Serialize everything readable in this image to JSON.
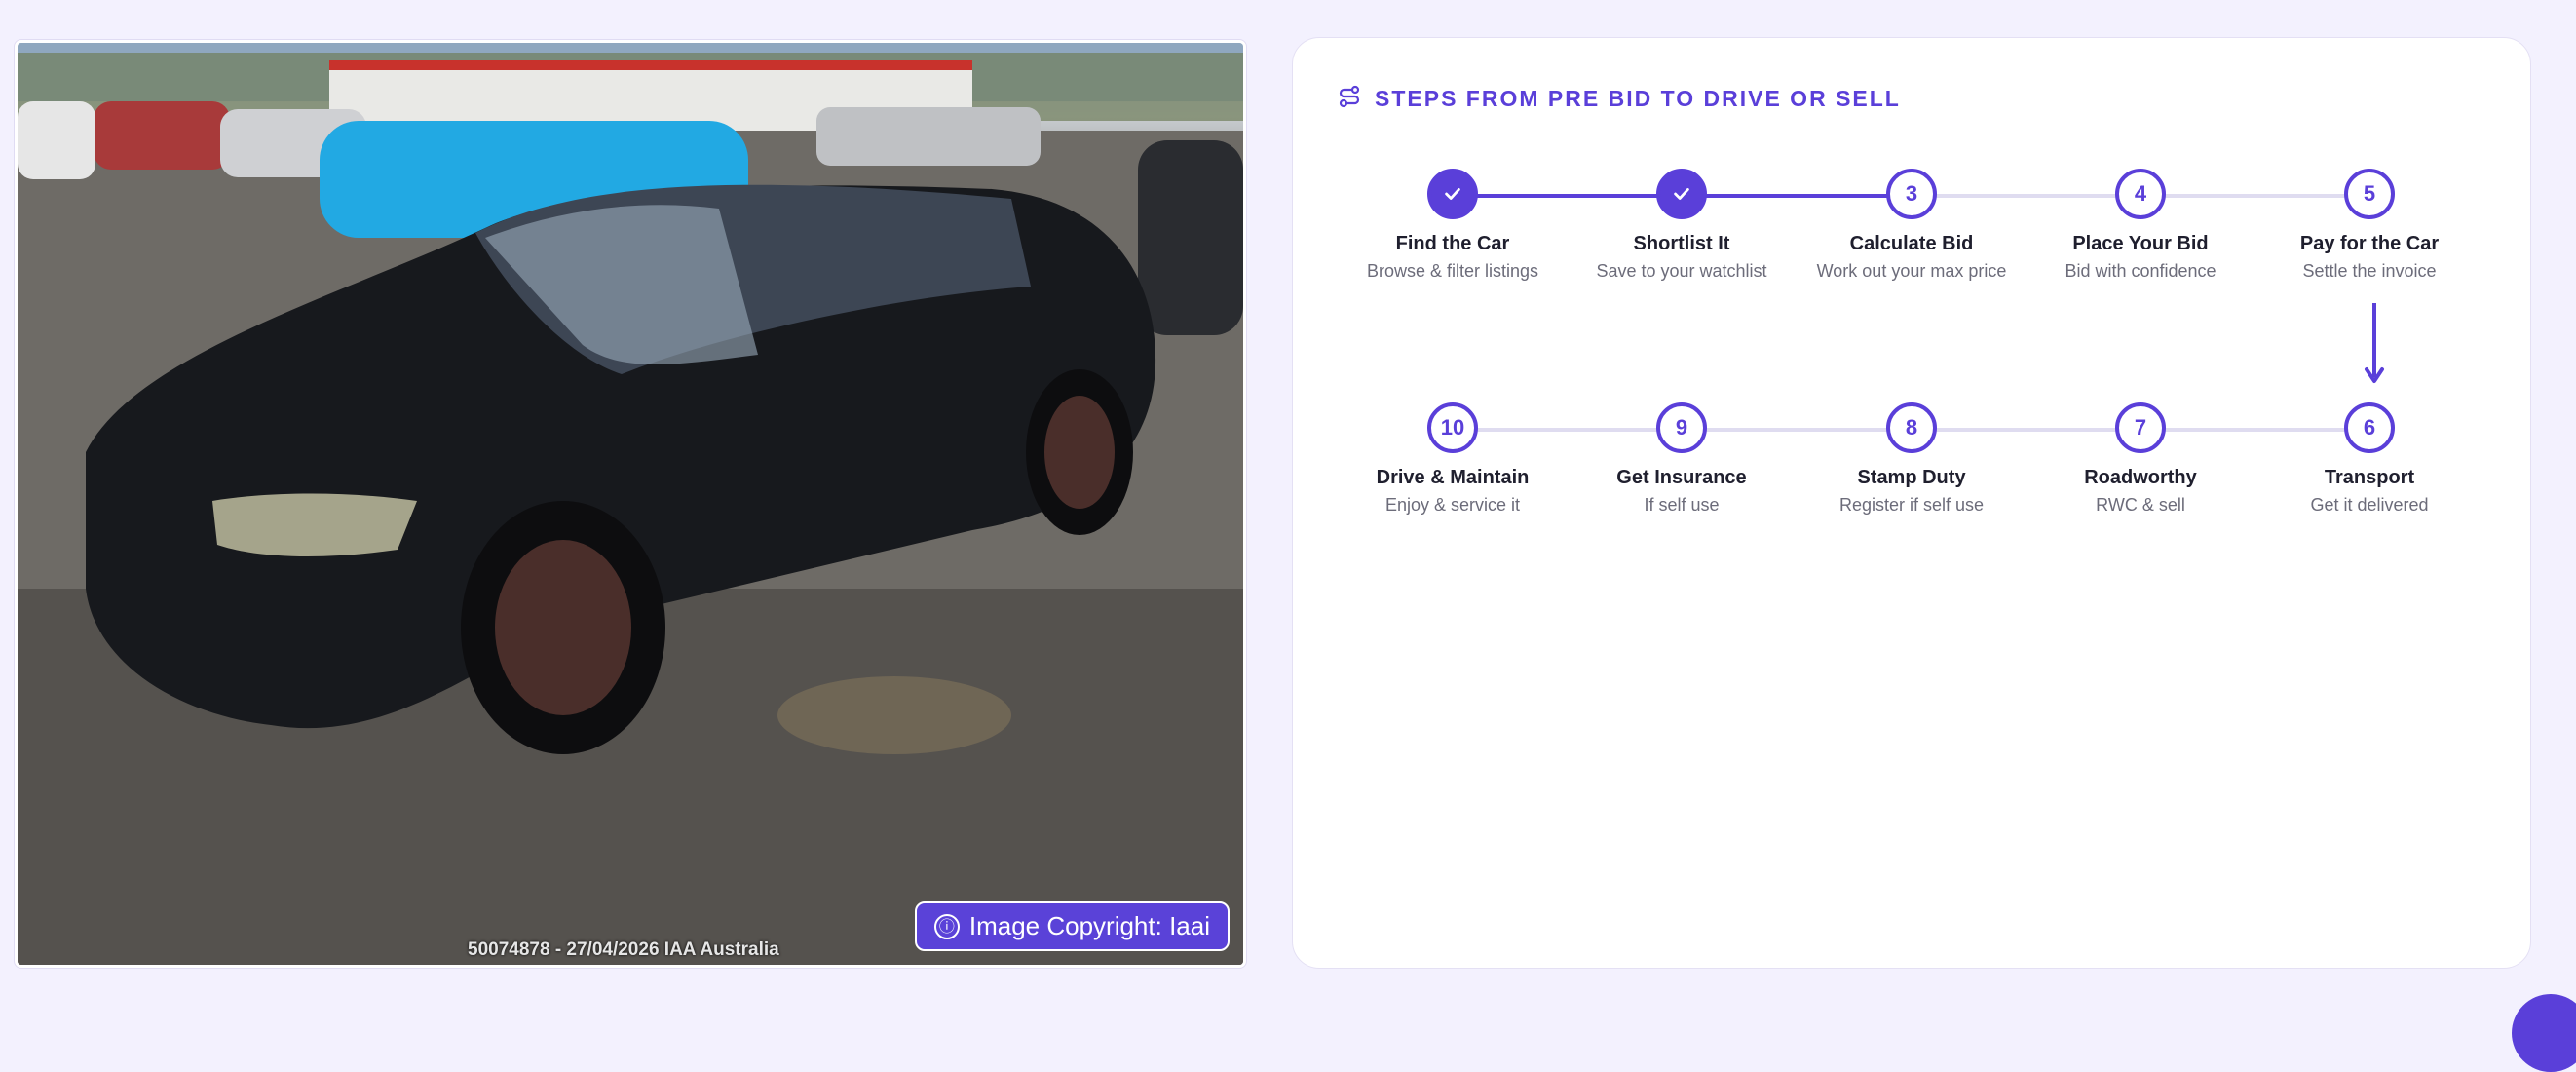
{
  "photo": {
    "watermark": "50074878 - 27/04/2026 IAA Australia",
    "copyright_label": "Image Copyright: Iaai",
    "info_icon": "ⓘ"
  },
  "steps_section": {
    "title": "STEPS FROM PRE BID TO DRIVE OR SELL",
    "icon": "route-icon",
    "accent_color": "#5a3fd9",
    "steps": [
      {
        "number": "1",
        "title": "Find the Car",
        "subtitle": "Browse & filter listings",
        "status": "done"
      },
      {
        "number": "2",
        "title": "Shortlist It",
        "subtitle": "Save to your watchlist",
        "status": "done"
      },
      {
        "number": "3",
        "title": "Calculate Bid",
        "subtitle": "Work out your max price",
        "status": "pending"
      },
      {
        "number": "4",
        "title": "Place Your Bid",
        "subtitle": "Bid with confidence",
        "status": "pending"
      },
      {
        "number": "5",
        "title": "Pay for the Car",
        "subtitle": "Settle the invoice",
        "status": "pending"
      },
      {
        "number": "6",
        "title": "Transport",
        "subtitle": "Get it delivered",
        "status": "pending"
      },
      {
        "number": "7",
        "title": "Roadworthy",
        "subtitle": "RWC & sell",
        "status": "pending"
      },
      {
        "number": "8",
        "title": "Stamp Duty",
        "subtitle": "Register if self use",
        "status": "pending"
      },
      {
        "number": "9",
        "title": "Get Insurance",
        "subtitle": "If self use",
        "status": "pending"
      },
      {
        "number": "10",
        "title": "Drive & Maintain",
        "subtitle": "Enjoy & service it",
        "status": "pending"
      }
    ]
  }
}
